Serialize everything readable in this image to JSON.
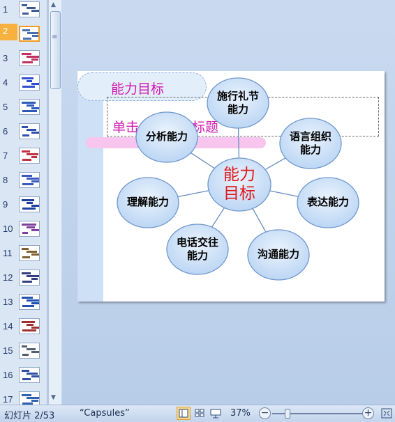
{
  "thumbnails": [
    {
      "number": "1"
    },
    {
      "number": "2",
      "selected": true
    },
    {
      "number": "3"
    },
    {
      "number": "4"
    },
    {
      "number": "5"
    },
    {
      "number": "6"
    },
    {
      "number": "7"
    },
    {
      "number": "8"
    },
    {
      "number": "9"
    },
    {
      "number": "10"
    },
    {
      "number": "11"
    },
    {
      "number": "12"
    },
    {
      "number": "13"
    },
    {
      "number": "14"
    },
    {
      "number": "15"
    },
    {
      "number": "16"
    },
    {
      "number": "17"
    }
  ],
  "slide": {
    "title": "能力目标",
    "subtitle_placeholder": "单击此处添加标题",
    "center": {
      "line1": "能力",
      "line2": "目标"
    },
    "nodes": [
      {
        "line1": "施行礼节",
        "line2": "能力"
      },
      {
        "line1": "语言组织",
        "line2": "能力"
      },
      {
        "line1": "表达能力",
        "line2": ""
      },
      {
        "line1": "沟通能力",
        "line2": ""
      },
      {
        "line1": "电话交往",
        "line2": "能力"
      },
      {
        "line1": "理解能力",
        "line2": ""
      },
      {
        "line1": "分析能力",
        "line2": ""
      }
    ]
  },
  "status": {
    "slide_info": "幻灯片 2/53",
    "theme": "“Capsules”",
    "zoom": "37%",
    "zoom_level": 0.37
  },
  "colors": {
    "title": "#d21ab0",
    "center_text": "#e0181c",
    "bubble_fill": "#bcd6f4",
    "bubble_border": "#6f97cc"
  }
}
